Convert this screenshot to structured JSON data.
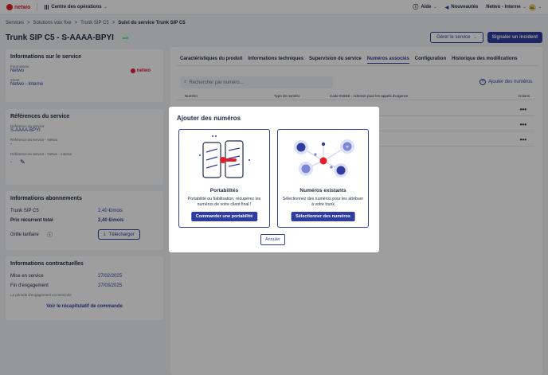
{
  "topbar": {
    "brand": "netwo",
    "app_menu": "Centre des opérations",
    "help": "Aide",
    "news": "Nouveautés",
    "account": "Netwo - Interne",
    "avatar_initials": "NL"
  },
  "breadcrumb": [
    "Services",
    "Solutions voix fixe",
    "Trunk SIP C5",
    "Suivi du service Trunk SIP C5"
  ],
  "page": {
    "title": "Trunk SIP C5 - S-AAAA-BPYI",
    "badge": "actif",
    "manage_button": "Gérer le service",
    "incident_button": "Signaler un incident"
  },
  "info_service": {
    "title": "Informations sur le service",
    "supplier_label": "Fournisseur",
    "supplier": "Netwo",
    "client_label": "Client",
    "client": "Netwo - Interne"
  },
  "refs": {
    "title": "Références du service",
    "ref_label": "Référence du service",
    "ref": "S-AAAA-BPYI",
    "ref_netwo_label": "Référence du service - Netwo",
    "ref_netwo": "-",
    "ref_internal_label": "Référence du service - Netwo - interne",
    "ref_internal": "-"
  },
  "subscription": {
    "title": "Informations abonnements",
    "rows": [
      {
        "label": "Trunk SIP C5",
        "value": "2,40 €/mois"
      },
      {
        "label": "Prix récurrent total",
        "value": "2,40 €/mois"
      }
    ],
    "grid_label": "Grille tarifaire",
    "download": "Télécharger"
  },
  "contract": {
    "title": "Informations contractuelles",
    "rows": [
      {
        "label": "Mise en service",
        "value": "27/02/2025"
      },
      {
        "label": "Fin d'engagement",
        "value": "27/03/2025"
      }
    ],
    "note": "La période d'engagement est terminée",
    "recap_link": "Voir le récapitulatif de commande"
  },
  "tabs": [
    "Caractéristiques du produit",
    "Informations techniques",
    "Supervision du service",
    "Numéros associés",
    "Configuration",
    "Historique des modifications"
  ],
  "numbers": {
    "search_placeholder": "Rechercher par numéro...",
    "add_label": "Ajouter des numéros",
    "columns": [
      "Numéro",
      "Type de numéro",
      "Code INSEE - Adresse pour les appels d'urgence",
      "Actions"
    ]
  },
  "modal": {
    "title": "Ajouter des numéros",
    "options": [
      {
        "title": "Portabilités",
        "desc": "Portabilité ou fiabilisation, récupérez les numéros de votre client final !",
        "button": "Commander une portabilité"
      },
      {
        "title": "Numéros existants",
        "desc": "Sélectionnez des numéros pour les attribuer à votre trunk",
        "button": "Sélectionner des numéros"
      }
    ],
    "cancel": "Annuler"
  },
  "colors": {
    "primary": "#2f3e9e",
    "brand": "#e0202d",
    "success": "#16a34a"
  }
}
